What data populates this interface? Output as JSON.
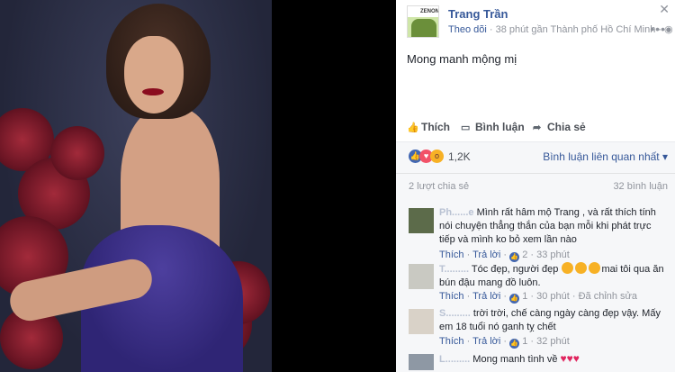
{
  "post": {
    "author": "Trang Trần",
    "follow": "Theo dõi",
    "meta_sep": " · ",
    "time_location": "38 phút gần Thành phố Hồ Chí Minh · ",
    "privacy_icon": "globe-icon",
    "text": "Mong manh mộng mị",
    "avatar_tag": "ZENON"
  },
  "actions": {
    "like": "Thích",
    "comment": "Bình luận",
    "share": "Chia sẻ"
  },
  "reactions": {
    "count": "1,2K",
    "related_comments": "Bình luận liên quan nhất ▾"
  },
  "stats": {
    "shares": "2 lượt chia sẻ",
    "comments": "32 bình luận"
  },
  "comments": [
    {
      "name": "Ph......e",
      "text": "Mình rất hâm mộ Trang , và rất thích tính nói chuyện thẳng thắn của bạn mỗi khi phát trực tiếp và mình ko bỏ xem lần nào",
      "like": "Thích",
      "reply": "Trả lời",
      "likes": "2",
      "time": "33 phút",
      "edited": ""
    },
    {
      "name": "T.........",
      "text": "Tóc đẹp, người đẹp",
      "text_after": "mai tôi qua ăn bún đậu mang đồ luôn.",
      "like": "Thích",
      "reply": "Trả lời",
      "likes": "1",
      "time": "30 phút",
      "edited": "Đã chỉnh sửa"
    },
    {
      "name": "S.........",
      "text": "trời trời, chế càng ngày càng đẹp vậy. Mấy em 18 tuổi nó ganh tỵ chết",
      "like": "Thích",
      "reply": "Trả lời",
      "likes": "1",
      "time": "32 phút",
      "edited": ""
    },
    {
      "name": "L.........",
      "text": "Mong manh tình về"
    }
  ],
  "colors": {
    "link": "#365899",
    "muted": "#90949c",
    "like_blue": "#4267b2",
    "heart_red": "#e0245e"
  }
}
